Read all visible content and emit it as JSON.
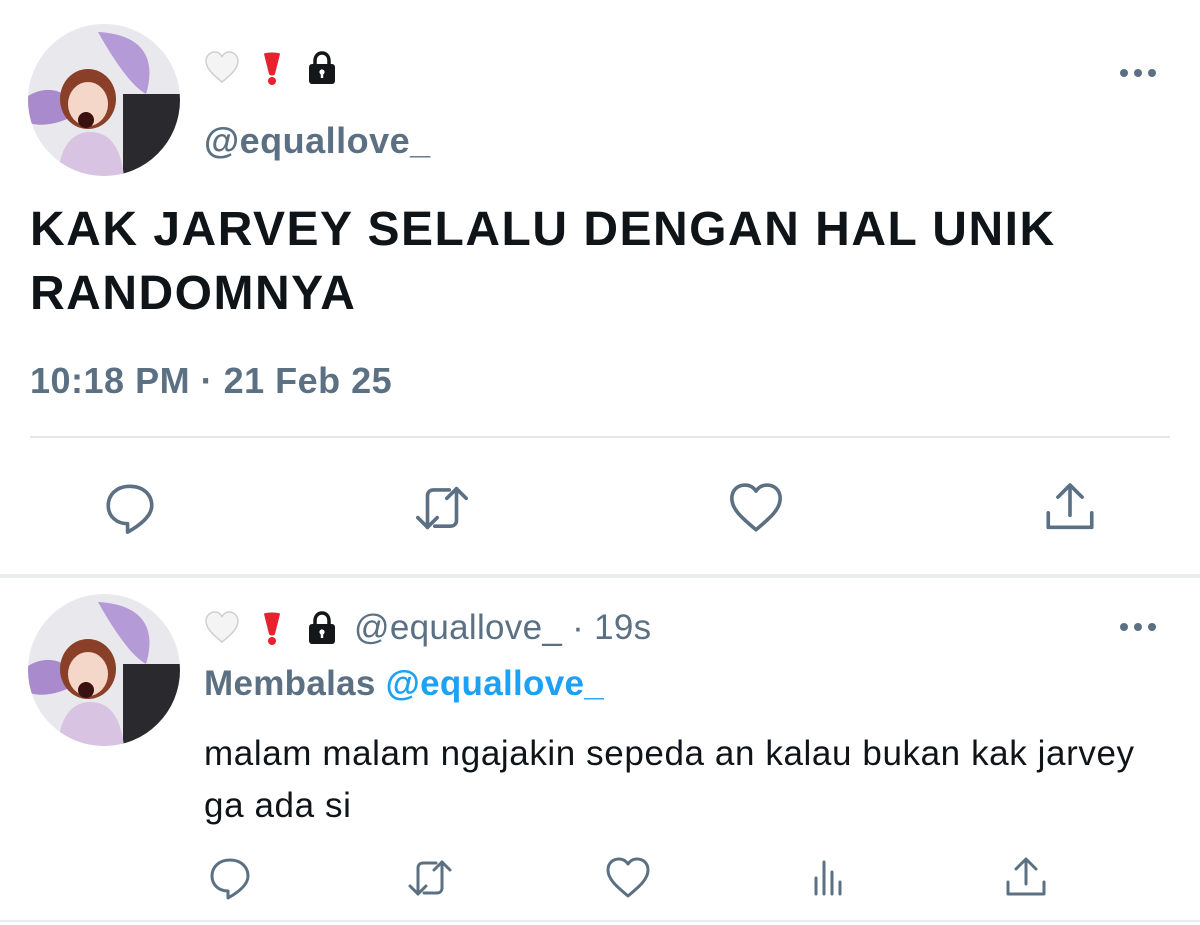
{
  "main_tweet": {
    "emojis": [
      "white-heart-icon",
      "red-exclamation-icon",
      "lock-icon"
    ],
    "handle": "@equallove_",
    "text": "KAK JARVEY SELALU DENGAN HAL UNIK RANDOMNYA",
    "timestamp": "10:18 PM · 21 Feb 25"
  },
  "reply_tweet": {
    "emojis": [
      "white-heart-icon",
      "red-exclamation-icon",
      "lock-icon"
    ],
    "meta": "@equallove_ · 19s",
    "replying_prefix": "Membalas ",
    "replying_handle": "@equallove_",
    "text": "malam malam ngajakin sepeda an kalau bukan kak jarvey ga ada si"
  },
  "actions_main": [
    "reply-icon",
    "retweet-icon",
    "like-icon",
    "share-icon"
  ],
  "actions_reply": [
    "reply-icon",
    "retweet-icon",
    "like-icon",
    "analytics-icon",
    "share-icon"
  ],
  "colors": {
    "secondary_text": "#5b7083",
    "accent_link": "#1da1f2",
    "primary_text": "#0f1419",
    "divider": "#e6ecf0"
  }
}
